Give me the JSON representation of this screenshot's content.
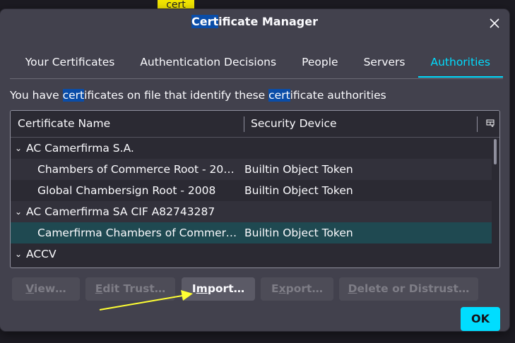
{
  "search_chip": {
    "text": "cert"
  },
  "dialog": {
    "title_hl": "Cert",
    "title_rest": "ificate Manager"
  },
  "tabs": [
    {
      "label": "Your Certificates",
      "active": false
    },
    {
      "label": "Authentication Decisions",
      "active": false
    },
    {
      "label": "People",
      "active": false
    },
    {
      "label": "Servers",
      "active": false
    },
    {
      "label": "Authorities",
      "active": true
    }
  ],
  "description": {
    "p1": "You have ",
    "hl1": "cert",
    "p2": "ificates on file that identify these ",
    "hl2": "cert",
    "p3": "ificate authorities"
  },
  "table": {
    "columns": [
      "Certificate Name",
      "Security Device"
    ],
    "rows": [
      {
        "type": "group",
        "name": "AC Camerfirma S.A.",
        "device": "",
        "twisty": "⌄"
      },
      {
        "type": "child",
        "name": "Chambers of Commerce Root - 200…",
        "device": "Builtin Object Token",
        "alt": true
      },
      {
        "type": "child",
        "name": "Global Chambersign Root - 2008",
        "device": "Builtin Object Token"
      },
      {
        "type": "group",
        "name": "AC Camerfirma SA CIF A82743287",
        "device": "",
        "twisty": "⌄",
        "alt": true
      },
      {
        "type": "child",
        "name": "Camerfirma Chambers of Commerc…",
        "device": "Builtin Object Token",
        "selected": true
      },
      {
        "type": "group",
        "name": "ACCV",
        "device": "",
        "twisty": "⌄"
      }
    ]
  },
  "buttons": {
    "view": {
      "underline": "V",
      "rest": "iew…",
      "enabled": false
    },
    "edit_trust": {
      "underline": "E",
      "rest": "dit Trust…",
      "enabled": false
    },
    "import": {
      "underline": "m",
      "prefix": "I",
      "rest": "port…",
      "enabled": true
    },
    "export": {
      "underline": "x",
      "prefix": "E",
      "rest": "port…",
      "enabled": false
    },
    "delete": {
      "underline": "D",
      "rest": "elete or Distrust…",
      "enabled": false
    },
    "ok": "OK"
  },
  "colors": {
    "accent": "#00ddff",
    "dialog_bg": "#42414d",
    "selected_row": "#1f4951",
    "highlight": "#0a4da8",
    "annotation_arrow": "#ffff33"
  },
  "icons": {
    "close": "close-icon",
    "column_picker": "column-picker-icon",
    "twisty": "chevron-down-icon"
  }
}
